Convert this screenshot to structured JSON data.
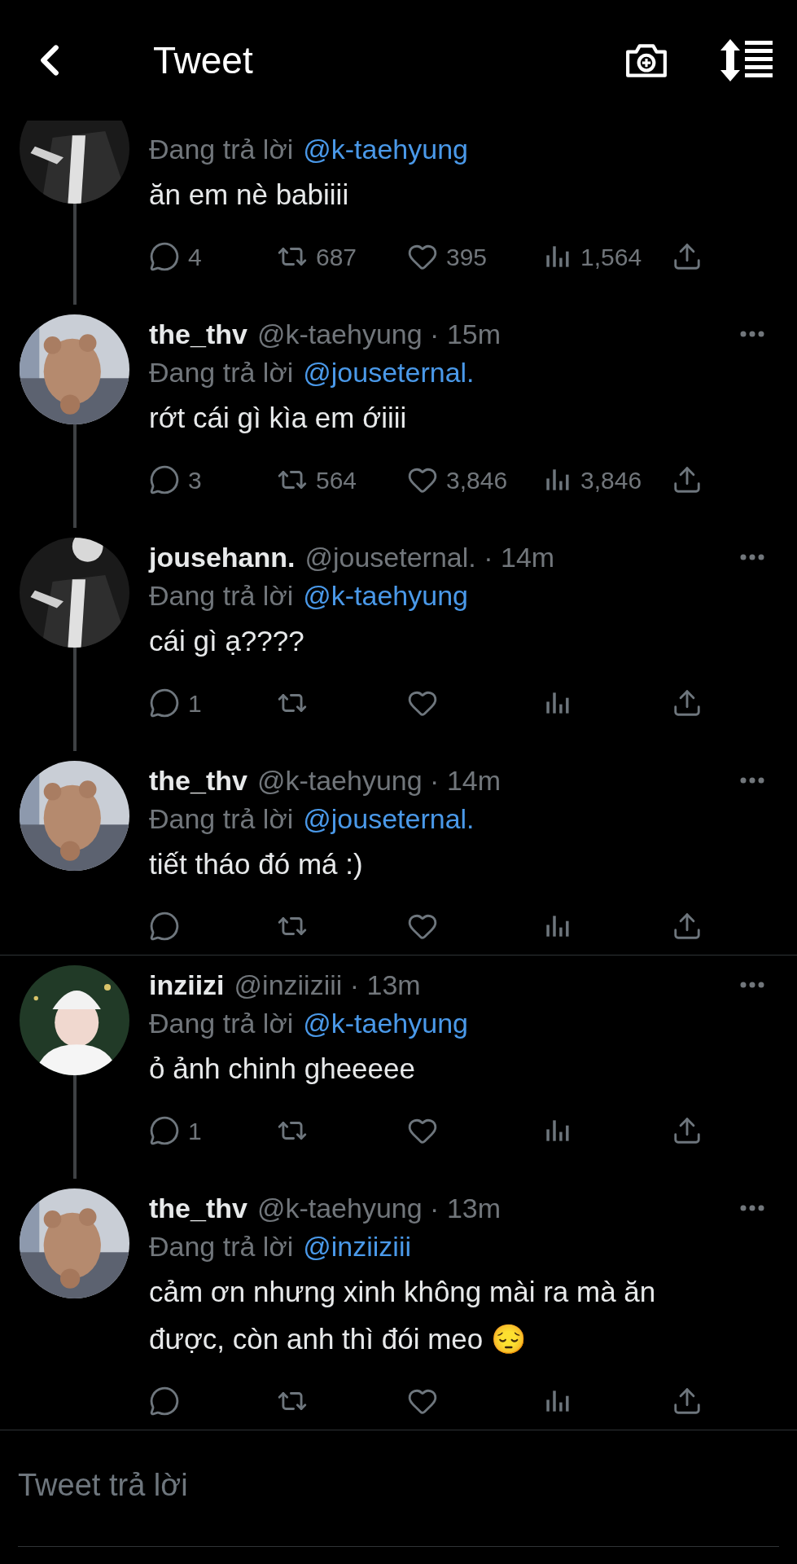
{
  "header": {
    "title": "Tweet"
  },
  "tweets": [
    {
      "cut_top": true,
      "reply_label": "Đang trả lời",
      "reply_to": "@k-taehyung",
      "text": "ăn em nè babiiii",
      "connected_below": true,
      "actions": [
        {
          "kind": "reply",
          "count": "4"
        },
        {
          "kind": "retweet",
          "count": "687"
        },
        {
          "kind": "like",
          "count": "395"
        },
        {
          "kind": "views",
          "count": "1,564"
        },
        {
          "kind": "share"
        }
      ]
    },
    {
      "cut_top": false,
      "name": "the_thv",
      "meta": "@k-taehyung · 15m",
      "reply_label": "Đang trả lời",
      "reply_to": "@jouseternal.",
      "text": "rớt cái gì kìa em ớiiii",
      "connected_below": true,
      "actions": [
        {
          "kind": "reply",
          "count": "3"
        },
        {
          "kind": "retweet",
          "count": "564"
        },
        {
          "kind": "like",
          "count": "3,846"
        },
        {
          "kind": "views",
          "count": "3,846"
        },
        {
          "kind": "share"
        }
      ]
    },
    {
      "cut_top": false,
      "name": "jousehann.",
      "meta": "@jouseternal. · 14m",
      "reply_label": "Đang trả lời",
      "reply_to": "@k-taehyung",
      "text": "cái gì ạ????",
      "connected_below": true,
      "actions": [
        {
          "kind": "reply",
          "count": "1"
        },
        {
          "kind": "retweet"
        },
        {
          "kind": "like"
        },
        {
          "kind": "views"
        },
        {
          "kind": "share"
        }
      ]
    },
    {
      "cut_top": false,
      "name": "the_thv",
      "meta": "@k-taehyung · 14m",
      "reply_label": "Đang trả lời",
      "reply_to": "@jouseternal.",
      "text": "tiết tháo đó má :)",
      "connected_below": false,
      "actions": [
        {
          "kind": "reply"
        },
        {
          "kind": "retweet"
        },
        {
          "kind": "like"
        },
        {
          "kind": "views"
        },
        {
          "kind": "share"
        }
      ]
    },
    {
      "cut_top": false,
      "name": "inziizi",
      "meta": "@inziiziii · 13m",
      "reply_label": "Đang trả lời",
      "reply_to": "@k-taehyung",
      "text": "ỏ ảnh chinh gheeeee",
      "connected_below": true,
      "actions": [
        {
          "kind": "reply",
          "count": "1"
        },
        {
          "kind": "retweet"
        },
        {
          "kind": "like"
        },
        {
          "kind": "views"
        },
        {
          "kind": "share"
        }
      ]
    },
    {
      "cut_top": false,
      "name": "the_thv",
      "meta": "@k-taehyung · 13m",
      "reply_label": "Đang trả lời",
      "reply_to": "@inziiziii",
      "text": "cảm ơn nhưng xinh không mài ra mà ăn được, còn anh thì đói meo 😔",
      "connected_below": false,
      "actions": [
        {
          "kind": "reply"
        },
        {
          "kind": "retweet"
        },
        {
          "kind": "like"
        },
        {
          "kind": "views"
        },
        {
          "kind": "share"
        }
      ]
    }
  ],
  "reply_field": {
    "placeholder": "Tweet trả lời"
  }
}
